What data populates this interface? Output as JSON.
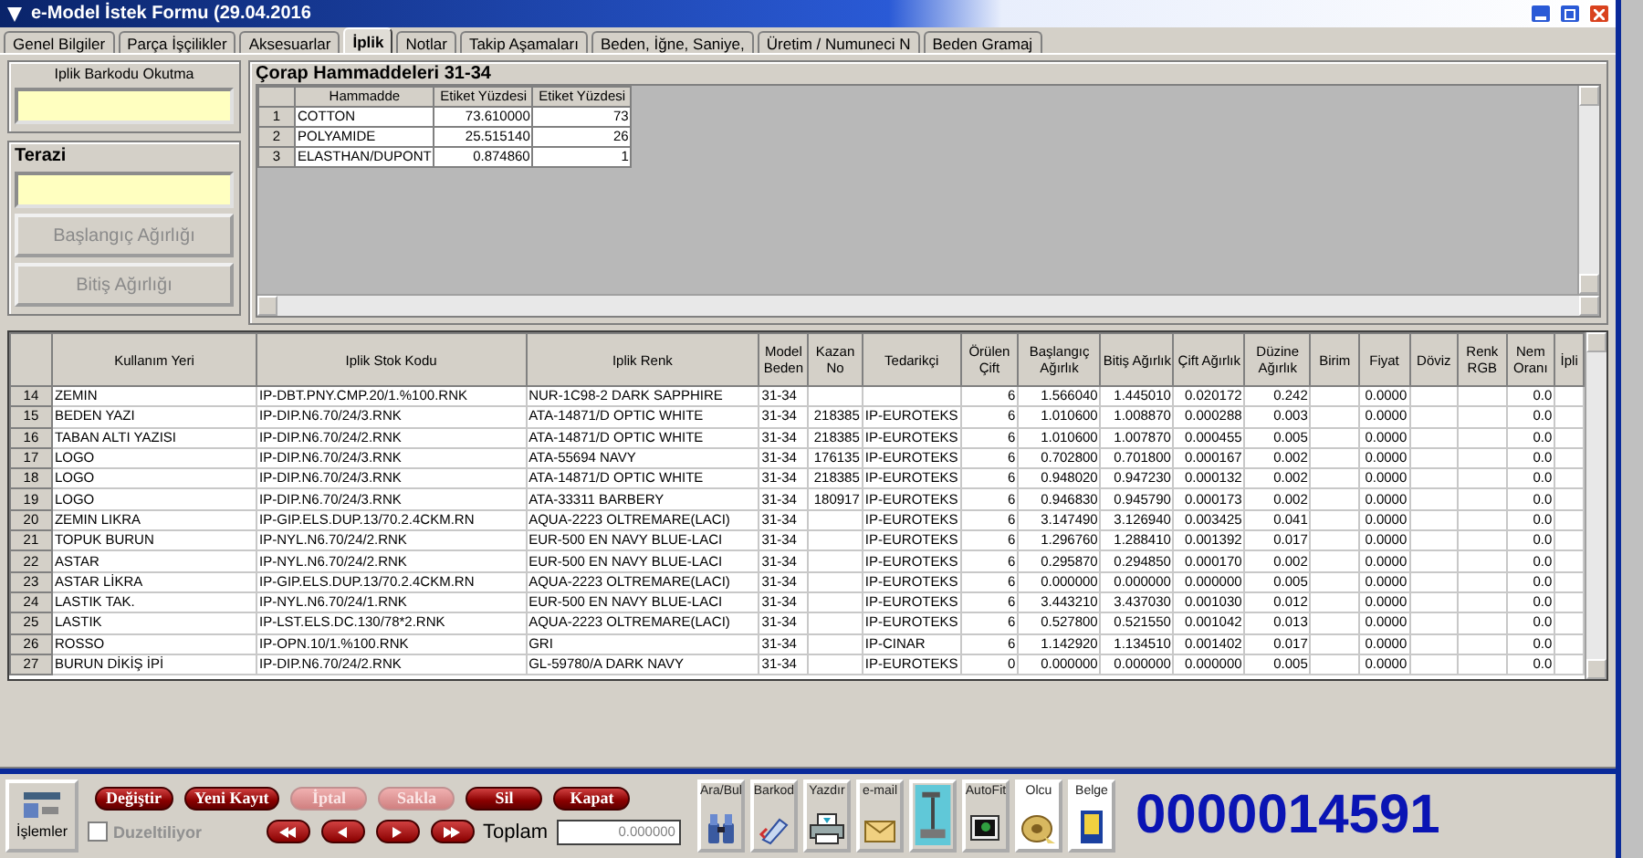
{
  "window": {
    "title": "e-Model İstek Formu (29.04.2016"
  },
  "tabs": [
    {
      "label": "Genel Bilgiler",
      "selected": false
    },
    {
      "label": "Parça İşçilikler",
      "selected": false
    },
    {
      "label": "Aksesuarlar",
      "selected": false
    },
    {
      "label": "İplik",
      "selected": true
    },
    {
      "label": "Notlar",
      "selected": false
    },
    {
      "label": "Takip Aşamaları",
      "selected": false
    },
    {
      "label": "Beden, İğne, Saniye,",
      "selected": false
    },
    {
      "label": "Üretim / Numuneci N",
      "selected": false
    },
    {
      "label": "Beden Gramaj",
      "selected": false
    }
  ],
  "barcode_panel": {
    "label": "Iplik Barkodu Okutma"
  },
  "scale_panel": {
    "title": "Terazi",
    "buttons": [
      {
        "label": "Başlangıç Ağırlığı",
        "disabled": true
      },
      {
        "label": "Bitiş Ağırlığı",
        "disabled": true
      }
    ]
  },
  "materials": {
    "title": "Çorap Hammaddeleri 31-34",
    "columns": [
      "Hammadde",
      "Etiket Yüzdesi",
      "Etiket Yüzdesi"
    ],
    "rows": [
      {
        "row": "1",
        "cells": [
          "COTTON",
          "73.610000",
          "73"
        ]
      },
      {
        "row": "2",
        "cells": [
          "POLYAMIDE",
          "25.515140",
          "26"
        ]
      },
      {
        "row": "3",
        "cells": [
          "ELASTHAN/DUPONT",
          "0.874860",
          "1"
        ]
      }
    ]
  },
  "grid": {
    "columns": [
      {
        "label": [
          "Kullanım Yeri"
        ],
        "kind": "text"
      },
      {
        "label": [
          "Iplik Stok Kodu"
        ],
        "kind": "text"
      },
      {
        "label": [
          "Iplik Renk"
        ],
        "kind": "text"
      },
      {
        "label": [
          "Model",
          "Beden"
        ],
        "kind": "text"
      },
      {
        "label": [
          "Kazan",
          "No"
        ],
        "kind": "number"
      },
      {
        "label": [
          "Tedarikçi"
        ],
        "kind": "text"
      },
      {
        "label": [
          "Örülen",
          "Çift"
        ],
        "kind": "number"
      },
      {
        "label": [
          "Başlangıç",
          "Ağırlık"
        ],
        "kind": "number"
      },
      {
        "label": [
          "Bitiş Ağırlık"
        ],
        "kind": "number"
      },
      {
        "label": [
          "Çift Ağırlık"
        ],
        "kind": "number"
      },
      {
        "label": [
          "Düzine",
          "Ağırlık"
        ],
        "kind": "number"
      },
      {
        "label": [
          "Birim"
        ]
      },
      {
        "label": [
          "Fiyat"
        ],
        "kind": "number"
      },
      {
        "label": [
          "Döviz"
        ]
      },
      {
        "label": [
          "Renk",
          "RGB"
        ]
      },
      {
        "label": [
          "Nem",
          "Oranı"
        ],
        "kind": "number"
      },
      {
        "label": [
          "İpli"
        ]
      }
    ],
    "rows": [
      {
        "row": "14",
        "cells": [
          "ZEMIN",
          "IP-DBT.PNY.CMP.20/1.%100.RNK",
          "NUR-1C98-2 DARK SAPPHIRE",
          "31-34",
          null,
          null,
          "6",
          "1.566040",
          "1.445010",
          "0.020172",
          "0.242",
          null,
          "0.0000",
          null,
          null,
          "0.0"
        ]
      },
      {
        "row": "15",
        "cells": [
          "BEDEN YAZI",
          "IP-DIP.N6.70/24/3.RNK",
          "ATA-14871/D OPTIC WHITE",
          "31-34",
          "218385",
          "IP-EUROTEKS",
          "6",
          "1.010600",
          "1.008870",
          "0.000288",
          "0.003",
          null,
          "0.0000",
          null,
          null,
          "0.0"
        ]
      },
      {
        "row": "16",
        "cells": [
          "TABAN ALTI YAZISI",
          "IP-DIP.N6.70/24/2.RNK",
          "ATA-14871/D OPTIC WHITE",
          "31-34",
          "218385",
          "IP-EUROTEKS",
          "6",
          "1.010600",
          "1.007870",
          "0.000455",
          "0.005",
          null,
          "0.0000",
          null,
          null,
          "0.0"
        ]
      },
      {
        "row": "17",
        "cells": [
          "LOGO",
          "IP-DIP.N6.70/24/3.RNK",
          "ATA-55694 NAVY",
          "31-34",
          "176135",
          "IP-EUROTEKS",
          "6",
          "0.702800",
          "0.701800",
          "0.000167",
          "0.002",
          null,
          "0.0000",
          null,
          null,
          "0.0"
        ]
      },
      {
        "row": "18",
        "cells": [
          "LOGO",
          "IP-DIP.N6.70/24/3.RNK",
          "ATA-14871/D OPTIC WHITE",
          "31-34",
          "218385",
          "IP-EUROTEKS",
          "6",
          "0.948020",
          "0.947230",
          "0.000132",
          "0.002",
          null,
          "0.0000",
          null,
          null,
          "0.0"
        ]
      },
      {
        "row": "19",
        "cells": [
          "LOGO",
          "IP-DIP.N6.70/24/3.RNK",
          "ATA-33311 BARBERY",
          "31-34",
          "180917",
          "IP-EUROTEKS",
          "6",
          "0.946830",
          "0.945790",
          "0.000173",
          "0.002",
          null,
          "0.0000",
          null,
          null,
          "0.0"
        ]
      },
      {
        "row": "20",
        "cells": [
          "ZEMIN LIKRA",
          "IP-GIP.ELS.DUP.13/70.2.4CKM.RN",
          "AQUA-2223 OLTREMARE(LACI)",
          "31-34",
          null,
          "IP-EUROTEKS",
          "6",
          "3.147490",
          "3.126940",
          "0.003425",
          "0.041",
          null,
          "0.0000",
          null,
          null,
          "0.0"
        ]
      },
      {
        "row": "21",
        "cells": [
          "TOPUK BURUN",
          "IP-NYL.N6.70/24/2.RNK",
          "EUR-500 EN NAVY BLUE-LACI",
          "31-34",
          null,
          "IP-EUROTEKS",
          "6",
          "1.296760",
          "1.288410",
          "0.001392",
          "0.017",
          null,
          "0.0000",
          null,
          null,
          "0.0"
        ]
      },
      {
        "row": "22",
        "cells": [
          "ASTAR",
          "IP-NYL.N6.70/24/2.RNK",
          "EUR-500 EN NAVY BLUE-LACI",
          "31-34",
          null,
          "IP-EUROTEKS",
          "6",
          "0.295870",
          "0.294850",
          "0.000170",
          "0.002",
          null,
          "0.0000",
          null,
          null,
          "0.0"
        ]
      },
      {
        "row": "23",
        "cells": [
          "ASTAR LİKRA",
          "IP-GIP.ELS.DUP.13/70.2.4CKM.RN",
          "AQUA-2223 OLTREMARE(LACI)",
          "31-34",
          null,
          "IP-EUROTEKS",
          "6",
          "0.000000",
          "0.000000",
          "0.000000",
          "0.005",
          null,
          "0.0000",
          null,
          null,
          "0.0"
        ]
      },
      {
        "row": "24",
        "cells": [
          "LASTIK TAK.",
          "IP-NYL.N6.70/24/1.RNK",
          "EUR-500 EN NAVY BLUE-LACI",
          "31-34",
          null,
          "IP-EUROTEKS",
          "6",
          "3.443210",
          "3.437030",
          "0.001030",
          "0.012",
          null,
          "0.0000",
          null,
          null,
          "0.0"
        ]
      },
      {
        "row": "25",
        "cells": [
          "LASTIK",
          "IP-LST.ELS.DC.130/78*2.RNK",
          "AQUA-2223 OLTREMARE(LACI)",
          "31-34",
          null,
          "IP-EUROTEKS",
          "6",
          "0.527800",
          "0.521550",
          "0.001042",
          "0.013",
          null,
          "0.0000",
          null,
          null,
          "0.0"
        ]
      },
      {
        "row": "26",
        "cells": [
          "ROSSO",
          "IP-OPN.10/1.%100.RNK",
          "GRI",
          "31-34",
          null,
          "IP-CINAR",
          "6",
          "1.142920",
          "1.134510",
          "0.001402",
          "0.017",
          null,
          "0.0000",
          null,
          null,
          "0.0"
        ]
      },
      {
        "row": "27",
        "cells": [
          "BURUN DİKİŞ İPİ",
          "IP-DIP.N6.70/24/2.RNK",
          "GL-59780/A DARK NAVY",
          "31-34",
          null,
          "IP-EUROTEKS",
          "0",
          "0.000000",
          "0.000000",
          "0.000000",
          "0.005",
          null,
          "0.0000",
          null,
          null,
          "0.0"
        ]
      }
    ]
  },
  "toolbar": {
    "menu_button": {
      "label": "İşlemler"
    },
    "actions": [
      {
        "label": "Değiştir",
        "disabled": false
      },
      {
        "label": "Yeni Kayıt",
        "disabled": false
      },
      {
        "label": "İptal",
        "disabled": true
      },
      {
        "label": "Sakla",
        "disabled": true
      },
      {
        "label": "Sil",
        "disabled": false
      },
      {
        "label": "Kapat",
        "disabled": false
      }
    ],
    "editing_checkbox": {
      "label": "Duzeltiliyor",
      "checked": false,
      "disabled": true
    },
    "navigation": [
      {
        "kind": "first"
      },
      {
        "kind": "prev"
      },
      {
        "kind": "next"
      },
      {
        "kind": "last"
      }
    ],
    "total": {
      "label": "Toplam",
      "value": "0.000000"
    },
    "tools": [
      {
        "label": "Ara/Bul",
        "kind": "binoculars"
      },
      {
        "label": "Barkod",
        "kind": "scanner"
      },
      {
        "label": "Yazdır",
        "kind": "printer"
      },
      {
        "label": "e-mail",
        "kind": "mail"
      },
      {
        "kind": "scale"
      },
      {
        "label": "AutoFit",
        "kind": "monitor"
      },
      {
        "label": "Olcu",
        "kind": "tape"
      },
      {
        "label": "Belge",
        "kind": "document"
      }
    ],
    "record_number": "0000014591"
  }
}
